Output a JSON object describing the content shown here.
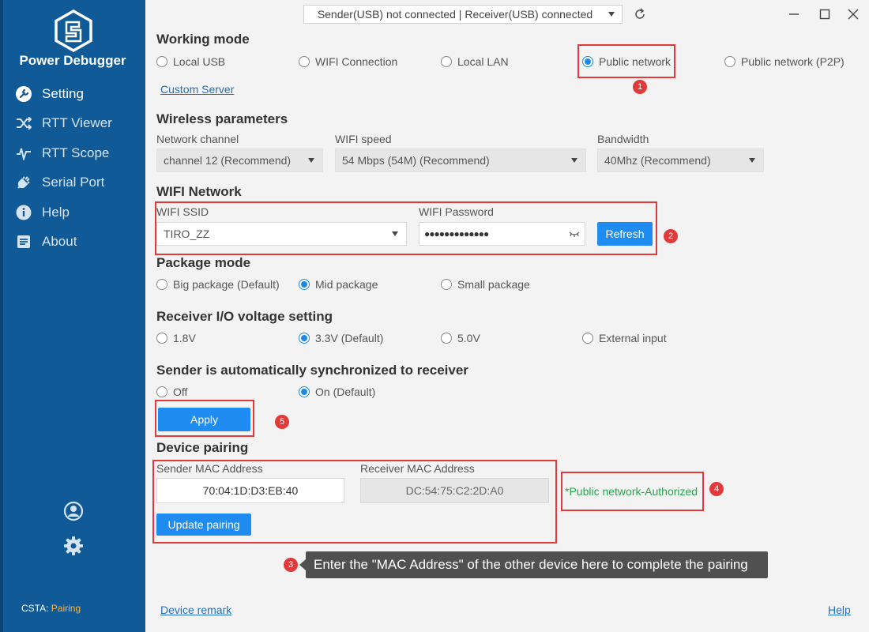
{
  "app": {
    "name": "Power Debugger"
  },
  "topbar": {
    "connection_status": "Sender(USB) not connected | Receiver(USB) connected"
  },
  "sidebar": {
    "items": [
      {
        "label": "Setting",
        "icon": "wrench-icon"
      },
      {
        "label": "RTT Viewer",
        "icon": "shuffle-icon"
      },
      {
        "label": "RTT Scope",
        "icon": "waveform-icon"
      },
      {
        "label": "Serial Port",
        "icon": "plug-icon"
      },
      {
        "label": "Help",
        "icon": "info-icon"
      },
      {
        "label": "About",
        "icon": "document-icon"
      }
    ],
    "csta_label": "CSTA:",
    "csta_value": "Pairing"
  },
  "working_mode": {
    "title": "Working mode",
    "options": [
      "Local USB",
      "WIFI Connection",
      "Local LAN",
      "Public network",
      "Public network (P2P)"
    ],
    "selected": "Public network",
    "custom_server": "Custom Server"
  },
  "wireless": {
    "title": "Wireless parameters",
    "channel_label": "Network channel",
    "channel_value": "channel 12 (Recommend)",
    "speed_label": "WIFI speed",
    "speed_value": "54 Mbps (54M)  (Recommend)",
    "bandwidth_label": "Bandwidth",
    "bandwidth_value": "40Mhz (Recommend)"
  },
  "wifi": {
    "title": "WIFI Network",
    "ssid_label": "WIFI SSID",
    "ssid_value": "TIRO_ZZ",
    "password_label": "WIFI Password",
    "password_value": "●●●●●●●●●●●●●",
    "refresh": "Refresh"
  },
  "package": {
    "title": "Package mode",
    "options": [
      "Big package (Default)",
      "Mid package",
      "Small package"
    ],
    "selected": "Mid package"
  },
  "voltage": {
    "title": "Receiver I/O voltage setting",
    "options": [
      "1.8V",
      "3.3V (Default)",
      "5.0V",
      "External input"
    ],
    "selected": "3.3V (Default)"
  },
  "sync": {
    "title": "Sender is automatically synchronized to receiver",
    "options": [
      "Off",
      "On (Default)"
    ],
    "selected": "On (Default)",
    "apply": "Apply"
  },
  "pairing": {
    "title": "Device pairing",
    "sender_label": "Sender MAC Address",
    "sender_value": "70:04:1D:D3:EB:40",
    "receiver_label": "Receiver MAC Address",
    "receiver_value": "DC:54:75:C2:2D:A0",
    "update": "Update pairing",
    "authorized": "*Public network-Authorized"
  },
  "annotations": {
    "badges": [
      "1",
      "2",
      "3",
      "4",
      "5"
    ],
    "tooltip": "Enter the \"MAC Address\" of the other device here to complete the pairing"
  },
  "footer": {
    "device_remark": "Device remark",
    "help": "Help"
  },
  "colors": {
    "sidebar": "#0f5a97",
    "accent": "#1e8cf0",
    "highlight": "#e23a3a",
    "status": "#22a84a",
    "csta": "#ffb340"
  }
}
